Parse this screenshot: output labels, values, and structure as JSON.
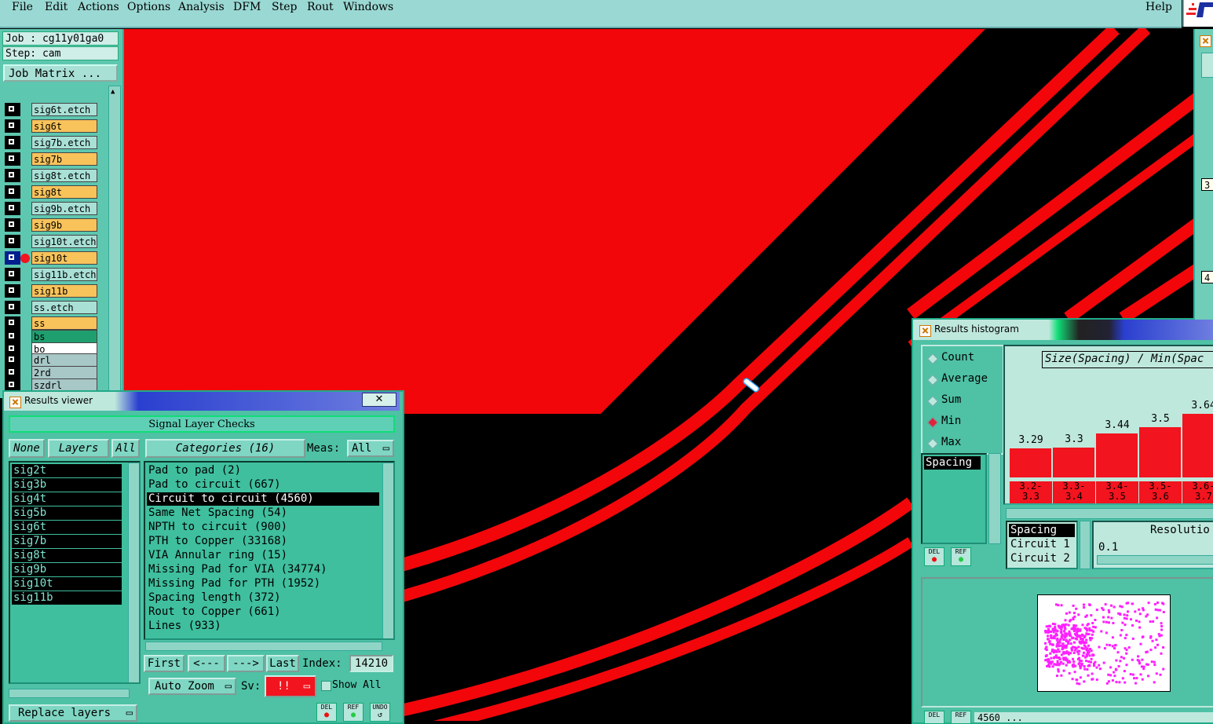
{
  "menubar": {
    "items": [
      "File",
      "Edit",
      "Actions",
      "Options",
      "Analysis",
      "DFM",
      "Step",
      "Rout",
      "Windows"
    ],
    "help": "Help"
  },
  "job": {
    "job_label": "Job : cg11y01ga0",
    "step_label": "Step: cam",
    "matrix_button": "Job Matrix ..."
  },
  "layers": [
    {
      "name": "sig6t.etch",
      "color": "#a8e0d6"
    },
    {
      "name": "sig6t",
      "color": "#f9c35b"
    },
    {
      "name": "sig7b.etch",
      "color": "#a8e0d6"
    },
    {
      "name": "sig7b",
      "color": "#f9c35b"
    },
    {
      "name": "sig8t.etch",
      "color": "#a8e0d6"
    },
    {
      "name": "sig8t",
      "color": "#f9c35b"
    },
    {
      "name": "sig9b.etch",
      "color": "#a8e0d6"
    },
    {
      "name": "sig9b",
      "color": "#f9c35b"
    },
    {
      "name": "sig10t.etch",
      "color": "#a8e0d6"
    },
    {
      "name": "sig10t",
      "color": "#f9c35b"
    },
    {
      "name": "sig11b.etch",
      "color": "#a8e0d6"
    },
    {
      "name": "sig11b",
      "color": "#f9c35b"
    },
    {
      "name": "ss.etch",
      "color": "#a8e0d6"
    },
    {
      "name": "ss",
      "color": "#f9c35b"
    },
    {
      "name": "bs",
      "color": "#1f9f6f"
    },
    {
      "name": "bo",
      "color": "#ffffff"
    },
    {
      "name": "drl",
      "color": "#a8c7c7"
    },
    {
      "name": "2rd",
      "color": "#a8c7c7"
    },
    {
      "name": "szdrl",
      "color": "#a8c7c7"
    }
  ],
  "results_viewer": {
    "title": "Results viewer",
    "close": "✕",
    "header": "Signal Layer Checks",
    "none_btn": "None",
    "layers_btn": "Layers",
    "all_btn": "All",
    "categories_btn": "Categories (16)",
    "meas_label": "Meas:",
    "meas_value": "All",
    "layer_list": [
      "sig2t",
      "sig3b",
      "sig4t",
      "sig5b",
      "sig6t",
      "sig7b",
      "sig8t",
      "sig9b",
      "sig10t",
      "sig11b"
    ],
    "categories": [
      "Pad to pad (2)",
      "Pad to circuit (667)",
      "Circuit to circuit (4560)",
      "Same Net Spacing (54)",
      "NPTH to circuit (900)",
      "PTH to Copper (33168)",
      "VIA Annular ring (15)",
      "Missing Pad for VIA (34774)",
      "Missing Pad for PTH (1952)",
      "Spacing length (372)",
      "Rout to Copper (661)",
      "Lines (933)"
    ],
    "selected_category": 2,
    "first_btn": "First",
    "prev_btn": "<---",
    "next_btn": "--->",
    "last_btn": "Last",
    "index_label": "Index:",
    "index_value": "14210",
    "autozoom_btn": "Auto Zoom",
    "sv_label": "Sv:",
    "sv_value": "!!",
    "show_all": "Show All",
    "replace_btn": "Replace layers",
    "del_btn": "DEL",
    "ref_btn": "REF",
    "undo_btn": "UNDO"
  },
  "histogram": {
    "title": "Results histogram",
    "modes": [
      "Count",
      "Average",
      "Sum",
      "Min",
      "Max"
    ],
    "selected_mode": "Min",
    "metric_list": [
      "Spacing"
    ],
    "heading": "Size(Spacing) / Min(Spac",
    "values": [
      "3.29",
      "3.3",
      "3.44",
      "3.5",
      "3.64"
    ],
    "bins": [
      [
        "3.2-",
        "3.3"
      ],
      [
        "3.3-",
        "3.4"
      ],
      [
        "3.4-",
        "3.5"
      ],
      [
        "3.5-",
        "3.6"
      ],
      [
        "3.6-",
        "3.7"
      ]
    ],
    "sort_list": [
      "Spacing",
      "Circuit 1",
      "Circuit 2"
    ],
    "resolution_label": "Resolutio",
    "resolution_value": "0.1",
    "del_btn": "DEL",
    "ref_btn": "REF",
    "status_text": "4560 ... "
  },
  "right_strip": {
    "val1": "3",
    "val2": "4"
  }
}
